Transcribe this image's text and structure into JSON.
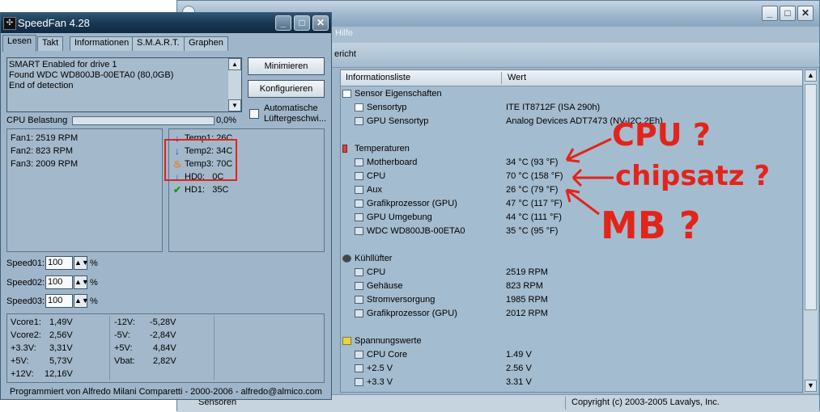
{
  "everest": {
    "menu_partial": "Hilfe",
    "toolbar_partial": "ericht",
    "header": {
      "col1": "Informationsliste",
      "col2": "Wert"
    },
    "rows": [
      {
        "kind": "group",
        "label": "Sensor Eigenschaften",
        "value": "",
        "indent": 0,
        "icon": "chip"
      },
      {
        "kind": "item",
        "label": "Sensortyp",
        "value": "ITE IT8712F  (ISA 290h)",
        "indent": 1,
        "icon": "chip"
      },
      {
        "kind": "item",
        "label": "GPU Sensortyp",
        "value": "Analog Devices ADT7473  (NV-I2C 2Eh)",
        "indent": 1,
        "icon": "gpu"
      },
      {
        "kind": "blank",
        "label": "",
        "value": "",
        "indent": 0,
        "icon": ""
      },
      {
        "kind": "group",
        "label": "Temperaturen",
        "value": "",
        "indent": 0,
        "icon": "temp"
      },
      {
        "kind": "item",
        "label": "Motherboard",
        "value": "34 °C  (93 °F)",
        "indent": 1,
        "icon": "board"
      },
      {
        "kind": "item",
        "label": "CPU",
        "value": "70 °C  (158 °F)",
        "indent": 1,
        "icon": "cpu"
      },
      {
        "kind": "item",
        "label": "Aux",
        "value": "26 °C  (79 °F)",
        "indent": 1,
        "icon": "gpu"
      },
      {
        "kind": "item",
        "label": "Grafikprozessor (GPU)",
        "value": "47 °C  (117 °F)",
        "indent": 1,
        "icon": "gpu"
      },
      {
        "kind": "item",
        "label": "GPU Umgebung",
        "value": "44 °C  (111 °F)",
        "indent": 1,
        "icon": "gpu"
      },
      {
        "kind": "item",
        "label": "WDC WD800JB-00ETA0",
        "value": "35 °C  (95 °F)",
        "indent": 1,
        "icon": "disk"
      },
      {
        "kind": "blank",
        "label": "",
        "value": "",
        "indent": 0,
        "icon": ""
      },
      {
        "kind": "group",
        "label": "Kühllüfter",
        "value": "",
        "indent": 0,
        "icon": "fan"
      },
      {
        "kind": "item",
        "label": "CPU",
        "value": "2519 RPM",
        "indent": 1,
        "icon": "cpu"
      },
      {
        "kind": "item",
        "label": "Gehäuse",
        "value": "823 RPM",
        "indent": 1,
        "icon": "case"
      },
      {
        "kind": "item",
        "label": "Stromversorgung",
        "value": "1985 RPM",
        "indent": 1,
        "icon": "psu"
      },
      {
        "kind": "item",
        "label": "Grafikprozessor (GPU)",
        "value": "2012 RPM",
        "indent": 1,
        "icon": "gpu"
      },
      {
        "kind": "blank",
        "label": "",
        "value": "",
        "indent": 0,
        "icon": ""
      },
      {
        "kind": "group",
        "label": "Spannungswerte",
        "value": "",
        "indent": 0,
        "icon": "warn"
      },
      {
        "kind": "item",
        "label": "CPU Core",
        "value": "1.49 V",
        "indent": 1,
        "icon": "cpu"
      },
      {
        "kind": "item",
        "label": "+2.5 V",
        "value": "2.56 V",
        "indent": 1,
        "icon": "cpu"
      },
      {
        "kind": "item",
        "label": "+3.3 V",
        "value": "3.31 V",
        "indent": 1,
        "icon": "cpu"
      }
    ],
    "status_left": "Sensoren",
    "status_right": "Copyright (c) 2003-2005 Lavalys, Inc."
  },
  "speedfan": {
    "title": "SpeedFan 4.28",
    "tabs": [
      "Lesen",
      "Takt",
      "Informationen",
      "S.M.A.R.T.",
      "Graphen"
    ],
    "active_tab": 0,
    "log": [
      "SMART Enabled for drive 1",
      "Found WDC WD800JB-00ETA0 (80,0GB)",
      "End of detection"
    ],
    "buttons": {
      "minimize": "Minimieren",
      "configure": "Konfigurieren"
    },
    "auto_fan": {
      "label_line1": "Automatische",
      "label_line2": "Lüftergeschwi...",
      "checked": false
    },
    "cpu_load": {
      "label": "CPU Belastung",
      "percent_text": "0,0%",
      "fraction": 0.0
    },
    "fans": [
      "Fan1: 2519 RPM",
      "Fan2: 823 RPM",
      "Fan3: 2009 RPM"
    ],
    "temps": [
      {
        "label": "Temp1:",
        "value": "26C",
        "icon": "arrow-down-icon"
      },
      {
        "label": "Temp2:",
        "value": "34C",
        "icon": "arrow-down-icon"
      },
      {
        "label": "Temp3:",
        "value": "70C",
        "icon": "flame-icon"
      },
      {
        "label": "HD0:",
        "value": "0C",
        "icon": "arrow-down-icon"
      },
      {
        "label": "HD1:",
        "value": "35C",
        "icon": "checkmark-icon"
      }
    ],
    "speeds": [
      {
        "label": "Speed01:",
        "value": "100",
        "unit": "%"
      },
      {
        "label": "Speed02:",
        "value": "100",
        "unit": "%"
      },
      {
        "label": "Speed03:",
        "value": "100",
        "unit": "%"
      }
    ],
    "voltages_left": [
      {
        "label": "Vcore1:",
        "value": "1,49V"
      },
      {
        "label": "Vcore2:",
        "value": "2,56V"
      },
      {
        "label": "+3.3V:",
        "value": "3,31V"
      },
      {
        "label": "+5V:",
        "value": "5,73V"
      },
      {
        "label": "+12V:",
        "value": "12,16V"
      }
    ],
    "voltages_right": [
      {
        "label": "-12V:",
        "value": "-5,28V"
      },
      {
        "label": "-5V:",
        "value": "-2,84V"
      },
      {
        "label": "+5V:",
        "value": "4,84V"
      },
      {
        "label": "Vbat:",
        "value": "2,82V"
      }
    ],
    "footer": "Programmiert von Alfredo Milani Comparetti - 2000-2006 - alfredo@almico.com"
  },
  "annotations": {
    "cpu": "CPU ?",
    "chipsatz": "chipsatz ?",
    "mb": "MB ?"
  },
  "colors": {
    "annotation": "#e3241b",
    "highlight_box": "#e0241c"
  }
}
